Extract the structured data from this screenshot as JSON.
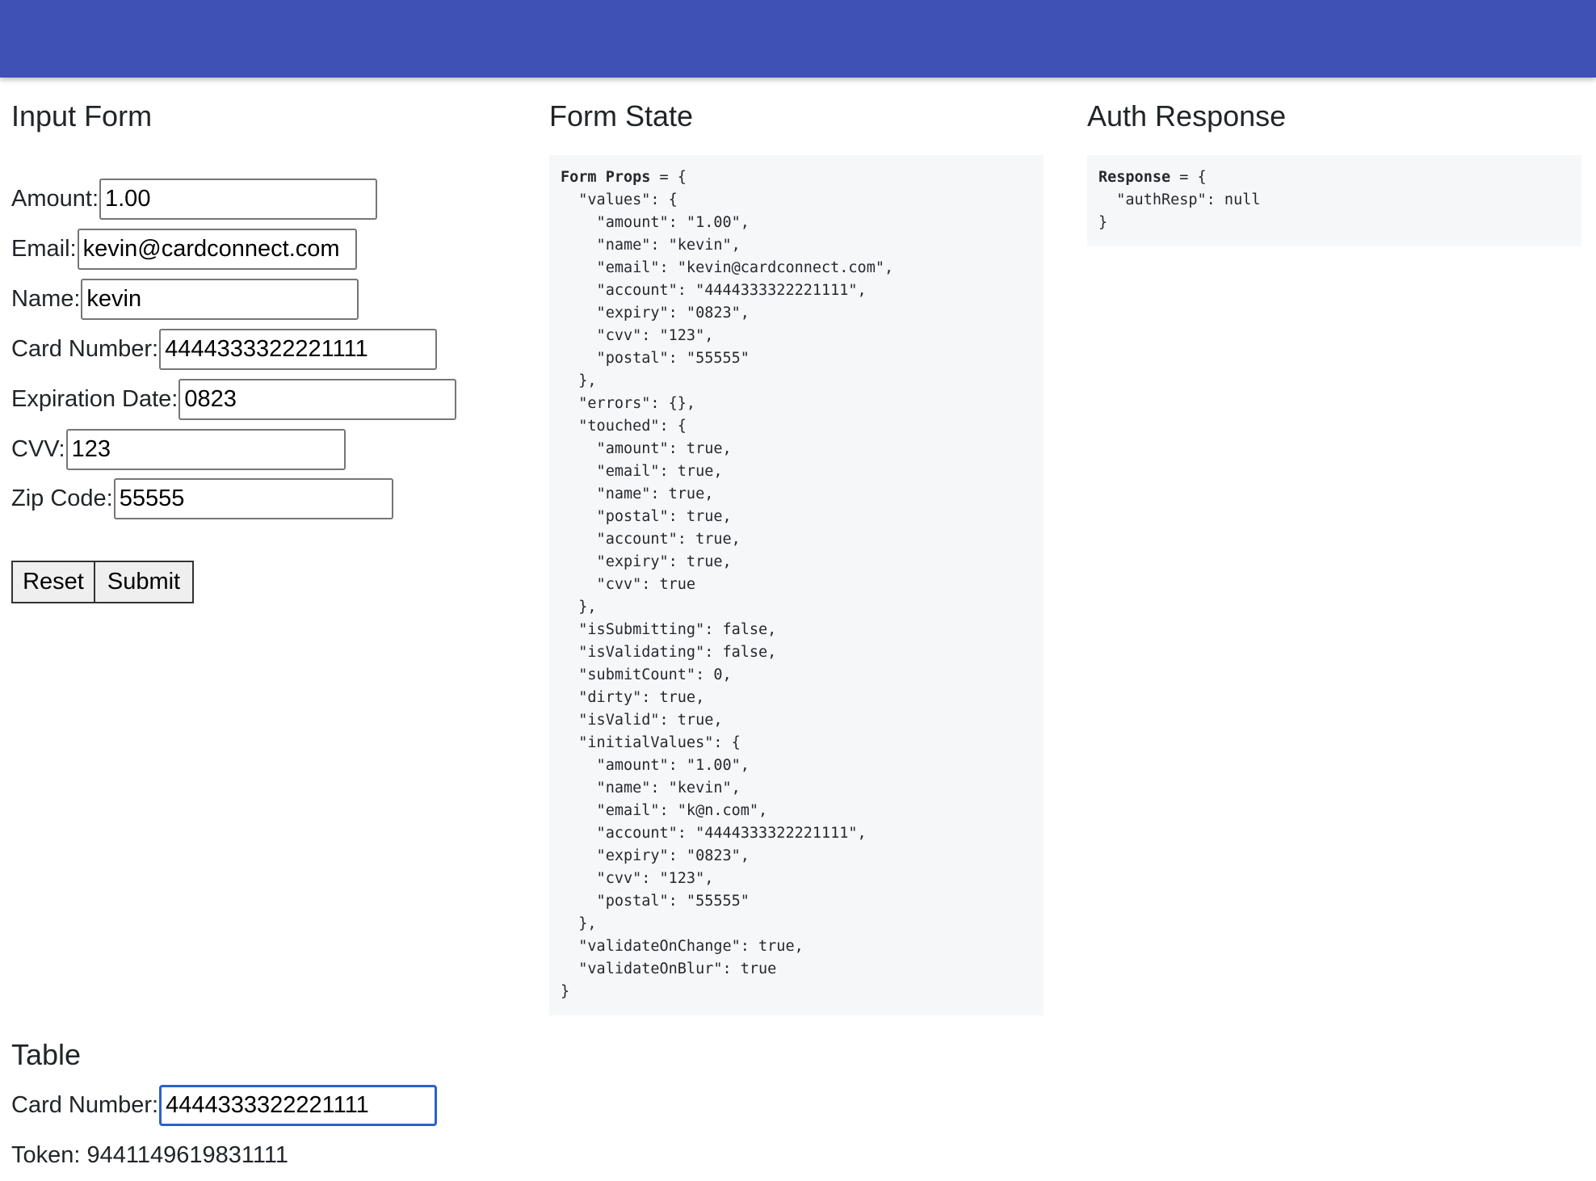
{
  "colors": {
    "appbar": "#3f51b5",
    "code_bg": "#f6f7f9",
    "focus": "#2962c9"
  },
  "input_form": {
    "title": "Input Form",
    "fields": [
      {
        "label": "Amount:",
        "value": "1.00"
      },
      {
        "label": "Email:",
        "value": "kevin@cardconnect.com"
      },
      {
        "label": "Name:",
        "value": "kevin"
      },
      {
        "label": "Card Number:",
        "value": "4444333322221111"
      },
      {
        "label": "Expiration Date:",
        "value": "0823"
      },
      {
        "label": "CVV:",
        "value": "123"
      },
      {
        "label": "Zip Code:",
        "value": "55555"
      }
    ],
    "reset_label": "Reset",
    "submit_label": "Submit"
  },
  "form_state": {
    "title": "Form State",
    "prefix": "Form Props",
    "open": " = {",
    "lines": [
      "  \"values\": {",
      "    \"amount\": \"1.00\",",
      "    \"name\": \"kevin\",",
      "    \"email\": \"kevin@cardconnect.com\",",
      "    \"account\": \"4444333322221111\",",
      "    \"expiry\": \"0823\",",
      "    \"cvv\": \"123\",",
      "    \"postal\": \"55555\"",
      "  },",
      "  \"errors\": {},",
      "  \"touched\": {",
      "    \"amount\": true,",
      "    \"email\": true,",
      "    \"name\": true,",
      "    \"postal\": true,",
      "    \"account\": true,",
      "    \"expiry\": true,",
      "    \"cvv\": true",
      "  },",
      "  \"isSubmitting\": false,",
      "  \"isValidating\": false,",
      "  \"submitCount\": 0,",
      "  \"dirty\": true,",
      "  \"isValid\": true,",
      "  \"initialValues\": {",
      "    \"amount\": \"1.00\",",
      "    \"name\": \"kevin\",",
      "    \"email\": \"k@n.com\",",
      "    \"account\": \"4444333322221111\",",
      "    \"expiry\": \"0823\",",
      "    \"cvv\": \"123\",",
      "    \"postal\": \"55555\"",
      "  },",
      "  \"validateOnChange\": true,",
      "  \"validateOnBlur\": true",
      "}"
    ]
  },
  "auth_response": {
    "title": "Auth Response",
    "prefix": "Response",
    "open": " = {",
    "lines": [
      "  \"authResp\": null",
      "}"
    ]
  },
  "table": {
    "title": "Table",
    "card_label": "Card Number:",
    "card_value": "4444333322221111",
    "token_text": "Token: 9441149619831111"
  }
}
